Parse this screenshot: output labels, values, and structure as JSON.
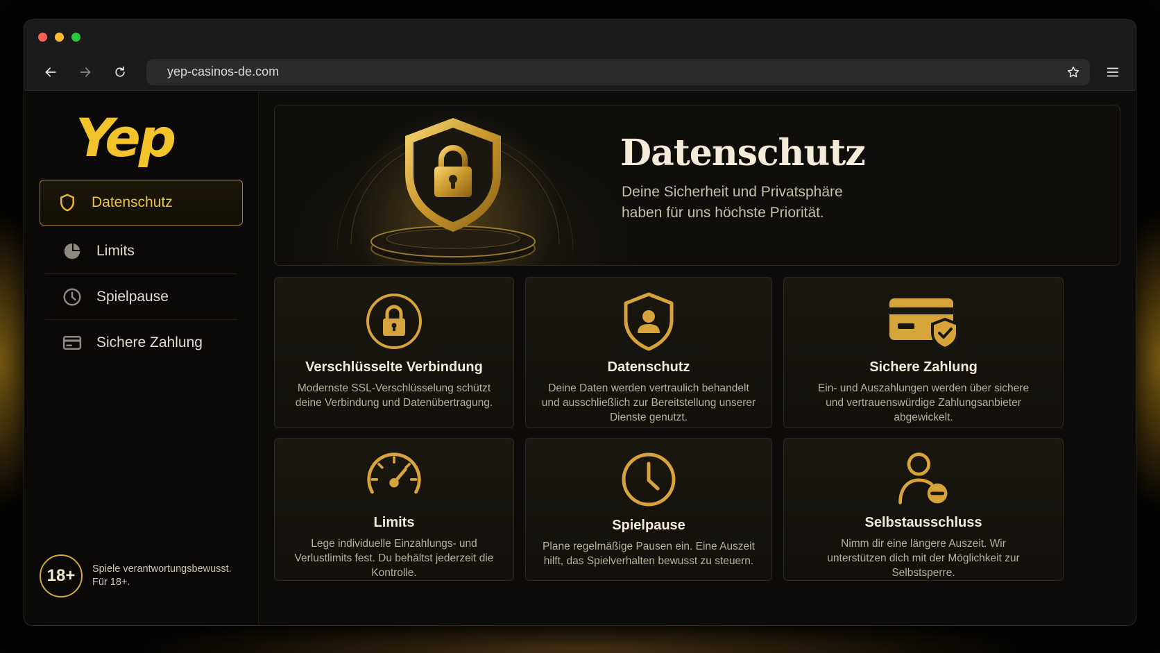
{
  "browser": {
    "url": "yep-casinos-de.com"
  },
  "brand": {
    "logo_text": "Yep",
    "accent_color": "#f2c32b"
  },
  "sidebar": {
    "items": [
      {
        "label": "Datenschutz",
        "icon": "shield-icon",
        "active": true
      },
      {
        "label": "Limits",
        "icon": "pie-chart-icon",
        "active": false
      },
      {
        "label": "Spielpause",
        "icon": "clock-icon",
        "active": false
      },
      {
        "label": "Sichere Zahlung",
        "icon": "credit-card-icon",
        "active": false
      }
    ],
    "age_badge": "18+",
    "age_text": "Spiele verantwortungsbewusst. Für 18+."
  },
  "hero": {
    "title": "Datenschutz",
    "subtitle_line1": "Deine Sicherheit und Privatsphäre",
    "subtitle_line2": "haben für uns höchste Priorität."
  },
  "cards": [
    {
      "title": "Verschlüsselte Verbindung",
      "icon": "lock-icon",
      "desc": "Modernste SSL-Verschlüsselung schützt deine Verbindung und Datenübertragung."
    },
    {
      "title": "Datenschutz",
      "icon": "shield-user-icon",
      "desc": "Deine Daten werden vertraulich behandelt und ausschließlich zur Bereitstellung unserer Dienste genutzt."
    },
    {
      "title": "Sichere Zahlung",
      "icon": "card-shield-icon",
      "desc": "Ein- und Auszahlungen werden über sichere und vertrauenswürdige Zahlungsanbieter abgewickelt."
    },
    {
      "title": "Limits",
      "icon": "gauge-icon",
      "desc": "Lege individuelle Einzahlungs- und Verlustlimits fest. Du behältst jederzeit die Kontrolle."
    },
    {
      "title": "Spielpause",
      "icon": "clock-icon",
      "desc": "Plane regelmäßige Pausen ein. Eine Auszeit hilft, das Spielverhalten bewusst zu steuern."
    },
    {
      "title": "Selbstausschluss",
      "icon": "user-minus-icon",
      "desc": "Nimm dir eine längere Auszeit. Wir unterstützen dich mit der Möglichkeit zur Selbstsperre."
    }
  ]
}
